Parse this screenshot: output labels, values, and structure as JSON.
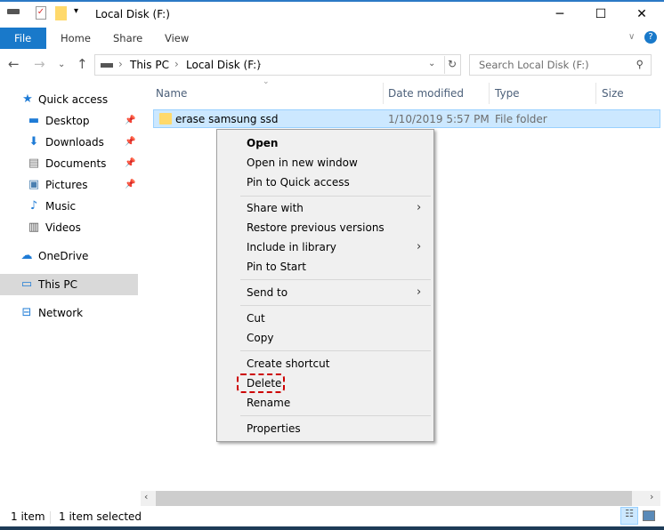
{
  "window": {
    "title": "Local Disk (F:)",
    "minimize": "─",
    "maximize": "☐",
    "close": "✕"
  },
  "ribbon": {
    "tabs": [
      "File",
      "Home",
      "Share",
      "View"
    ],
    "help": "?"
  },
  "address": {
    "crumbs": [
      "This PC",
      "Local Disk (F:)"
    ],
    "search_placeholder": "Search Local Disk (F:)"
  },
  "nav": {
    "items": [
      {
        "label": "Quick access",
        "icon": "star-icon",
        "pinned": false
      },
      {
        "label": "Desktop",
        "icon": "desktop-icon",
        "pinned": true
      },
      {
        "label": "Downloads",
        "icon": "download-icon",
        "pinned": true
      },
      {
        "label": "Documents",
        "icon": "documents-icon",
        "pinned": true
      },
      {
        "label": "Pictures",
        "icon": "pictures-icon",
        "pinned": true
      },
      {
        "label": "Music",
        "icon": "music-icon",
        "pinned": false
      },
      {
        "label": "Videos",
        "icon": "videos-icon",
        "pinned": false
      },
      {
        "label": "OneDrive",
        "icon": "cloud-icon",
        "pinned": false
      },
      {
        "label": "This PC",
        "icon": "pc-icon",
        "pinned": false
      },
      {
        "label": "Network",
        "icon": "network-icon",
        "pinned": false
      }
    ]
  },
  "columns": [
    "Name",
    "Date modified",
    "Type",
    "Size"
  ],
  "files": [
    {
      "name": "erase samsung ssd",
      "date": "1/10/2019 5:57 PM",
      "type": "File folder",
      "size": ""
    }
  ],
  "context_menu": {
    "items": [
      "Open",
      "Open in new window",
      "Pin to Quick access",
      "Share with",
      "Restore previous versions",
      "Include in library",
      "Pin to Start",
      "Send to",
      "Cut",
      "Copy",
      "Create shortcut",
      "Delete",
      "Rename",
      "Properties"
    ]
  },
  "status": {
    "count": "1 item",
    "selected": "1 item selected"
  },
  "colors": {
    "accent": "#1979ca",
    "selection": "#cce8ff",
    "highlight": "#cc0000"
  }
}
